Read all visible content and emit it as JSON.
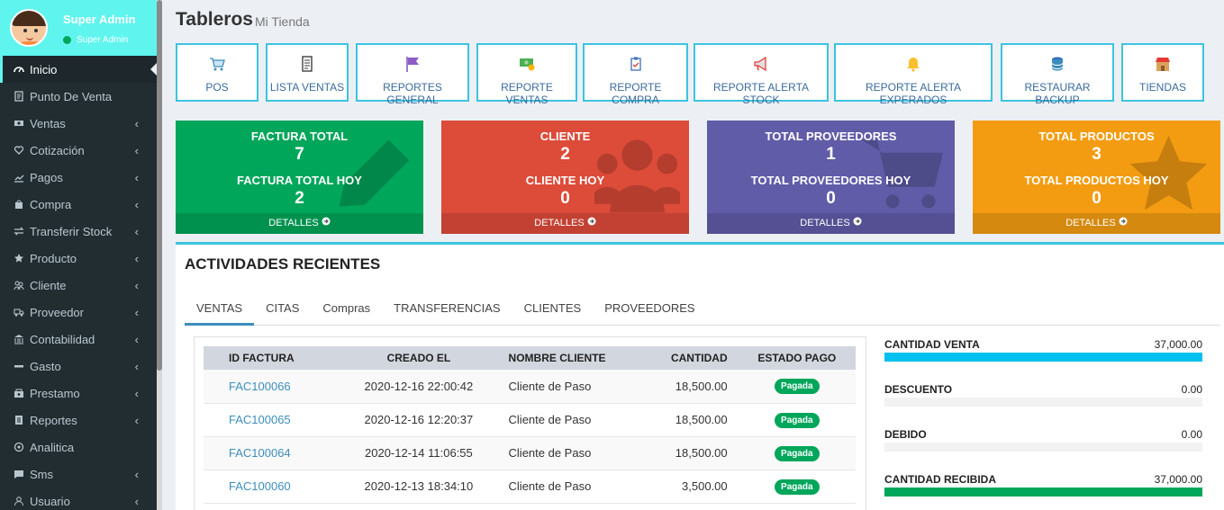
{
  "sidebar": {
    "user_name": "Super Admin",
    "user_role": "Super Admin",
    "items": [
      {
        "label": "Inicio",
        "icon": "dashboard-icon",
        "active": true
      },
      {
        "label": "Punto De Venta",
        "icon": "pos-icon"
      },
      {
        "label": "Ventas",
        "icon": "money-icon",
        "chevron": "‹"
      },
      {
        "label": "Cotización",
        "icon": "heart-icon",
        "chevron": "‹"
      },
      {
        "label": "Pagos",
        "icon": "chart-icon",
        "chevron": "‹"
      },
      {
        "label": "Compra",
        "icon": "bag-icon",
        "chevron": "‹"
      },
      {
        "label": "Transferir Stock",
        "icon": "exchange-icon",
        "chevron": "‹"
      },
      {
        "label": "Producto",
        "icon": "star-icon",
        "chevron": "‹"
      },
      {
        "label": "Cliente",
        "icon": "users-icon",
        "chevron": "‹"
      },
      {
        "label": "Proveedor",
        "icon": "truck-icon",
        "chevron": "‹"
      },
      {
        "label": "Contabilidad",
        "icon": "bank-icon",
        "chevron": "‹"
      },
      {
        "label": "Gasto",
        "icon": "minus-icon",
        "chevron": "‹"
      },
      {
        "label": "Prestamo",
        "icon": "loan-icon",
        "chevron": "‹"
      },
      {
        "label": "Reportes",
        "icon": "report-icon",
        "chevron": "‹"
      },
      {
        "label": "Analitica",
        "icon": "analytics-icon"
      },
      {
        "label": "Sms",
        "icon": "sms-icon",
        "chevron": "‹"
      },
      {
        "label": "Usuario",
        "icon": "user-icon",
        "chevron": "‹"
      }
    ]
  },
  "header": {
    "title": "Tableros",
    "subtitle": "Mi Tienda"
  },
  "tiles": [
    {
      "label": "POS",
      "icon": "cart-icon"
    },
    {
      "label": "LISTA VENTAS",
      "icon": "receipt-icon"
    },
    {
      "label": "REPORTES GENERAL",
      "icon": "flag-icon"
    },
    {
      "label": "REPORTE VENTAS",
      "icon": "cash-icon"
    },
    {
      "label": "REPORTE COMPRA",
      "icon": "clipboard-icon"
    },
    {
      "label": "REPORTE ALERTA STOCK",
      "icon": "megaphone-icon"
    },
    {
      "label": "REPORTE ALERTA EXPERADOS",
      "icon": "bell-icon"
    },
    {
      "label": "RESTAURAR BACKUP",
      "icon": "database-icon"
    },
    {
      "label": "TIENDAS",
      "icon": "store-icon"
    }
  ],
  "boxes": [
    {
      "label1": "FACTURA TOTAL",
      "value1": "7",
      "label2": "FACTURA TOTAL HOY",
      "value2": "2",
      "footer": "DETALLES",
      "color": "#00a65a",
      "icon": "pencil-icon"
    },
    {
      "label1": "CLIENTE",
      "value1": "2",
      "label2": "CLIENTE HOY",
      "value2": "0",
      "footer": "DETALLES",
      "color": "#dd4b39",
      "icon": "users-icon"
    },
    {
      "label1": "TOTAL PROVEEDORES",
      "value1": "1",
      "label2": "TOTAL PROVEEDORES HOY",
      "value2": "0",
      "footer": "DETALLES",
      "color": "#605ca8",
      "icon": "cart-icon"
    },
    {
      "label1": "TOTAL PRODUCTOS",
      "value1": "3",
      "label2": "TOTAL PRODUCTOS HOY",
      "value2": "0",
      "footer": "DETALLES",
      "color": "#f39c12",
      "icon": "star-icon"
    }
  ],
  "activity": {
    "title": "ACTIVIDADES RECIENTES",
    "tabs": [
      "VENTAS",
      "CITAS",
      "Compras",
      "TRANSFERENCIAS",
      "CLIENTES",
      "PROVEEDORES"
    ],
    "columns": [
      "ID FACTURA",
      "CREADO EL",
      "NOMBRE CLIENTE",
      "CANTIDAD",
      "ESTADO PAGO"
    ],
    "rows": [
      {
        "id": "FAC100066",
        "created": "2020-12-16 22:00:42",
        "client": "Cliente de Paso",
        "amount": "18,500.00",
        "status": "Pagada"
      },
      {
        "id": "FAC100065",
        "created": "2020-12-16 12:20:37",
        "client": "Cliente de Paso",
        "amount": "18,500.00",
        "status": "Pagada"
      },
      {
        "id": "FAC100064",
        "created": "2020-12-14 11:06:55",
        "client": "Cliente de Paso",
        "amount": "18,500.00",
        "status": "Pagada"
      },
      {
        "id": "FAC100060",
        "created": "2020-12-13 18:34:10",
        "client": "Cliente de Paso",
        "amount": "3,500.00",
        "status": "Pagada"
      }
    ],
    "stats": [
      {
        "label": "CANTIDAD VENTA",
        "value": "37,000.00",
        "fill": 1.0,
        "color": "#00c0ef"
      },
      {
        "label": "DESCUENTO",
        "value": "0.00",
        "fill": 0,
        "color": "#dd4b39"
      },
      {
        "label": "DEBIDO",
        "value": "0.00",
        "fill": 0,
        "color": "#f39c12"
      },
      {
        "label": "CANTIDAD RECIBIDA",
        "value": "37,000.00",
        "fill": 1.0,
        "color": "#00a65a"
      }
    ]
  }
}
